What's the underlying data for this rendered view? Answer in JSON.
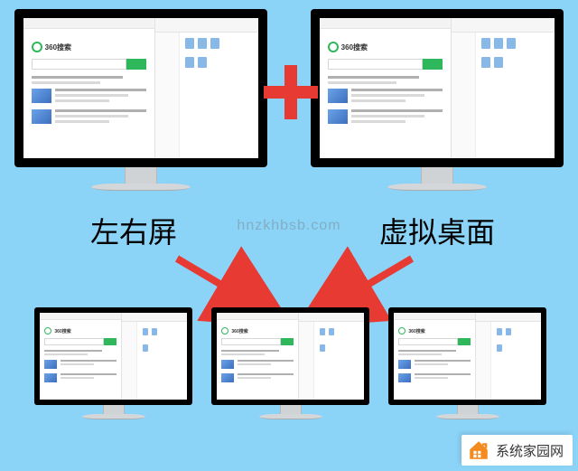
{
  "labels": {
    "left_right_screen": "左右屏",
    "virtual_desktop": "虚拟桌面"
  },
  "search": {
    "brand": "360搜索"
  },
  "watermark": {
    "center": "hnzkhbsb.com",
    "corner_text": "系统家园网"
  },
  "colors": {
    "bg": "#8bd4f8",
    "accent_red": "#e63a33",
    "accent_green": "#2fb85b",
    "accent_orange": "#f58a1f"
  }
}
